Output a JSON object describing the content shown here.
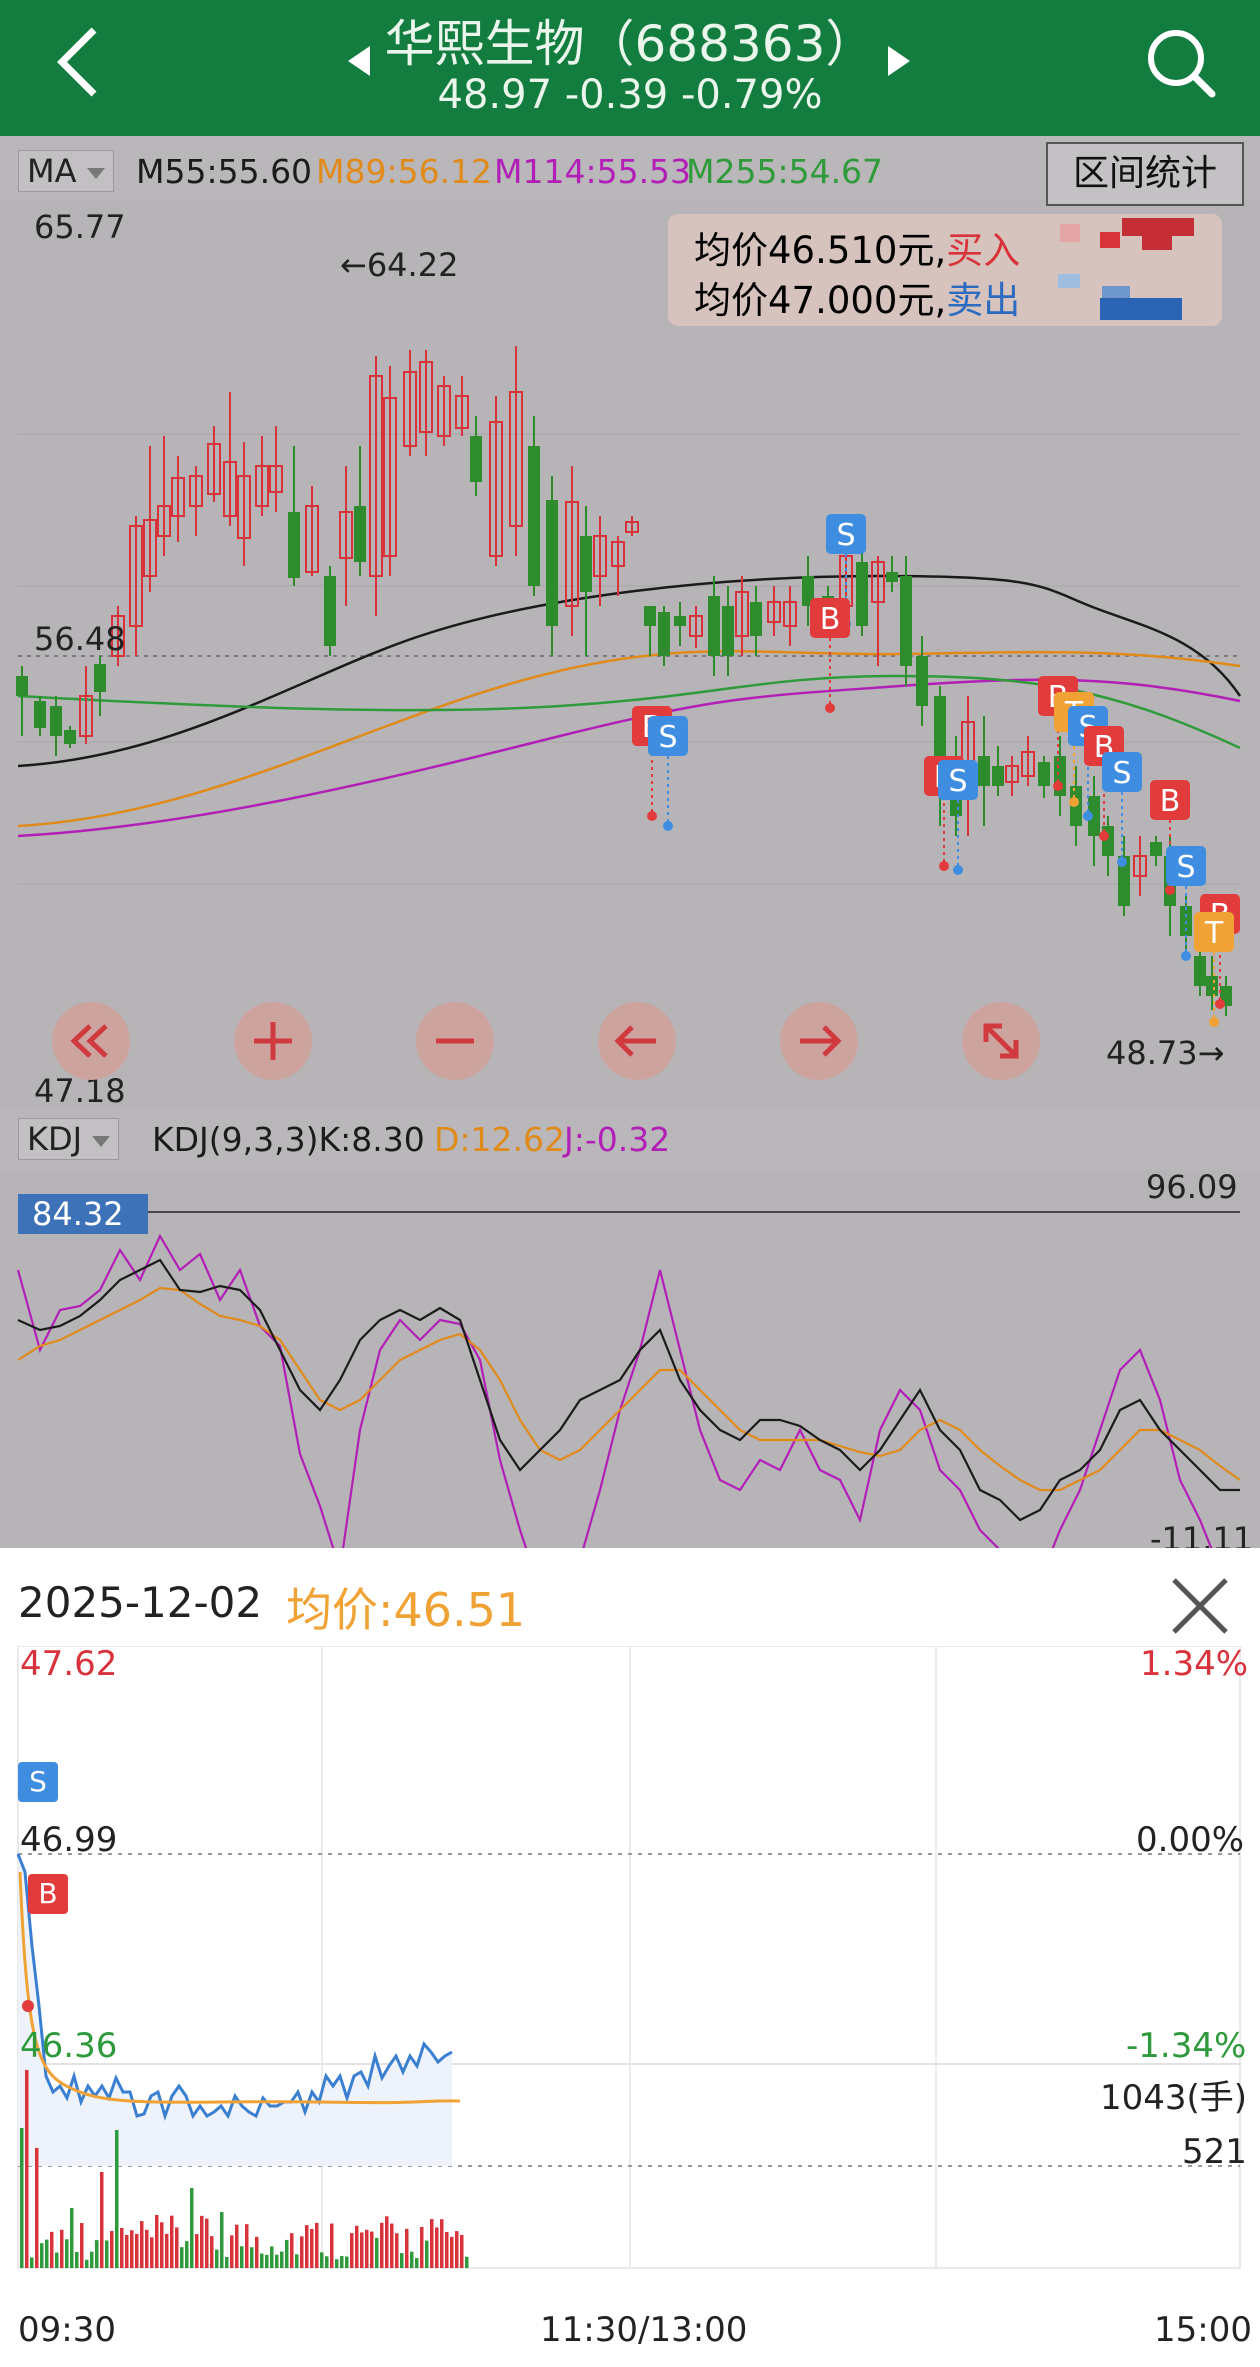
{
  "header": {
    "title": "华熙生物（688363）",
    "quote": "48.97  -0.39  -0.79%"
  },
  "ma_bar": {
    "selector": "MA",
    "values": [
      {
        "label": "M55:55.60",
        "color": "#1b1b1b"
      },
      {
        "label": "M89:56.12",
        "color": "#e08a1a"
      },
      {
        "label": "M114:55.53",
        "color": "#b21fb6"
      },
      {
        "label": "M255:54.67",
        "color": "#2f9a3a"
      }
    ],
    "interval_button": "区间统计"
  },
  "main_chart": {
    "y_max_label": "65.77",
    "y_min_label": "47.18",
    "ref_label": "56.48",
    "high_label": "←64.22",
    "last_label": "48.73→",
    "colors": {
      "up": "#d8333a",
      "down": "#2e8b2e"
    }
  },
  "avg_box": {
    "buy_prefix": "均价46.510元,",
    "buy_word": "买入",
    "sell_prefix": "均价47.000元,",
    "sell_word": "卖出"
  },
  "trade_markers": {
    "buy": "B",
    "sell": "S",
    "t": "T"
  },
  "controls": [
    "double-left-icon",
    "zoom-in-icon",
    "zoom-out-icon",
    "arrow-left-icon",
    "arrow-right-icon",
    "expand-icon"
  ],
  "kdj_bar": {
    "selector": "KDJ",
    "params": "KDJ(9,3,3)",
    "k": "K:8.30",
    "d": "D:12.62",
    "j": "J:-0.32",
    "top_label": "96.09",
    "bottom_label": "-11.11",
    "marker": "84.32"
  },
  "detail": {
    "date": "2025-12-02",
    "avg": "均价:46.51",
    "price_high": "47.62",
    "price_mid": "46.99",
    "price_low": "46.36",
    "pct_high": "1.34%",
    "pct_mid": "0.00%",
    "pct_low": "-1.34%",
    "vol_max": "1043(手)",
    "vol_mid": "521",
    "time_start": "09:30",
    "time_mid": "11:30/13:00",
    "time_end": "15:00",
    "sell_marker": "S",
    "buy_marker": "B"
  }
}
